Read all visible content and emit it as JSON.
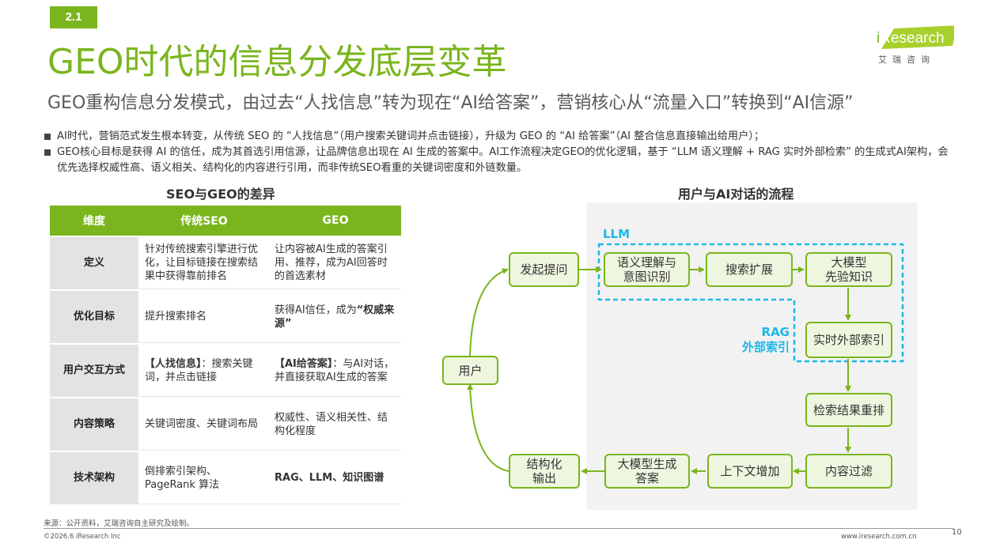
{
  "header": {
    "badge": "2.1",
    "title": "GEO时代的信息分发底层变革",
    "subtitle": "GEO重构信息分发模式，由过去“人找信息”转为现在“AI给答案”，营销核心从“流量入口”转换到“AI信源”"
  },
  "logo": {
    "text_i": "i",
    "text_rest": "Research",
    "subtext": "艾瑞咨询",
    "colors": {
      "green": "#7ab51d",
      "lime": "#a8d02c"
    }
  },
  "bullets": [
    "AI时代，营销范式发生根本转变，从传统 SEO 的 “人找信息”（用户搜索关键词并点击链接），升级为 GEO 的 “AI 给答案”（AI 整合信息直接输出给用户）；",
    "GEO核心目标是获得 AI 的信任，成为其首选引用信源，让品牌信息出现在 AI 生成的答案中。AI工作流程决定GEO的优化逻辑，基于 “LLM 语义理解 + RAG 实时外部检索” 的生成式AI架构，会优先选择权威性高、语义相关、结构化的内容进行引用，而非传统SEO看重的关键词密度和外链数量。"
  ],
  "table": {
    "title": "SEO与GEO的差异",
    "headers": [
      "维度",
      "传统SEO",
      "GEO"
    ],
    "rows": [
      {
        "dim": "定义",
        "seo": "针对传统搜索引擎进行优化，让目标链接在搜索结果中获得靠前排名",
        "geo": "让内容被AI生成的答案引用、推荐，成为AI回答时的首选素材"
      },
      {
        "dim": "优化目标",
        "seo": "提升搜索排名",
        "geo_pre": "获得AI信任，成为",
        "geo_bold": "“权威来源”"
      },
      {
        "dim": "用户交互方式",
        "seo_bold": "【人找信息】",
        "seo_rest": "：搜索关键词，并点击链接",
        "geo_bold": "【AI给答案】",
        "geo_rest": "：与AI对话，并直接获取AI生成的答案"
      },
      {
        "dim": "内容策略",
        "seo": "关键词密度、关键词布局",
        "geo": "权威性、语义相关性、结构化程度"
      },
      {
        "dim": "技术架构",
        "seo": "倒排索引架构、PageRank 算法",
        "geo": "RAG、LLM、知识图谱"
      }
    ]
  },
  "flow": {
    "title": "用户与AI对话的流程",
    "llm_label": "LLM",
    "rag_label_1": "RAG",
    "rag_label_2": "外部索引",
    "nodes": {
      "user": "用户",
      "ask": "发起提问",
      "semantic_1": "语义理解与",
      "semantic_2": "意图识别",
      "expand": "搜索扩展",
      "prior_1": "大模型",
      "prior_2": "先验知识",
      "realtime": "实时外部索引",
      "rerank": "检索结果重排",
      "filter": "内容过滤",
      "context": "上下文增加",
      "generate_1": "大模型生成",
      "generate_2": "答案",
      "output_1": "结构化",
      "output_2": "输出"
    },
    "colors": {
      "green": "#7ab51d",
      "node_fill": "#eef6df",
      "dashed": "#1eb7e6",
      "panel": "#f2f2f2"
    }
  },
  "footer": {
    "source": "来源：公开资料，艾瑞咨询自主研究及绘制。",
    "copyright": "©2026.6 iResearch Inc",
    "website": "www.iresearch.com.cn",
    "page": "10"
  }
}
